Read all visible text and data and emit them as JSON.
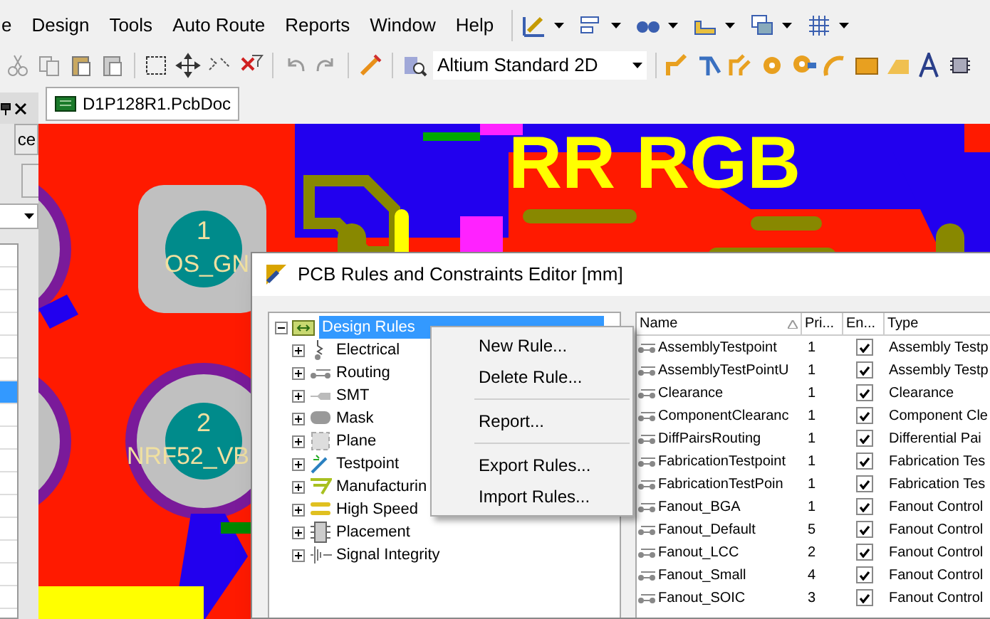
{
  "menu_bar": {
    "items": [
      "e",
      "Design",
      "Tools",
      "Auto Route",
      "Reports",
      "Window",
      "Help"
    ]
  },
  "toolbar": {
    "view_combo": {
      "value": "Altium Standard 2D"
    }
  },
  "left_panel": {
    "buttons": [
      "ce"
    ],
    "rows": [
      {
        "selected": false
      },
      {
        "selected": false
      },
      {
        "selected": false
      },
      {
        "selected": false
      },
      {
        "selected": false
      },
      {
        "selected": false
      },
      {
        "selected": true
      },
      {
        "selected": false
      },
      {
        "selected": false
      },
      {
        "selected": false
      },
      {
        "selected": false
      },
      {
        "selected": false
      },
      {
        "selected": false
      },
      {
        "selected": false
      },
      {
        "selected": false
      },
      {
        "selected": false
      }
    ]
  },
  "document_tabs": [
    {
      "label": "D1P128R1.PcbDoc",
      "selected": true
    }
  ],
  "pcb_canvas": {
    "silkscreen_text": "RR RGB",
    "pads": [
      {
        "number": "1",
        "net": "OS_GN"
      },
      {
        "number": "2",
        "net": "NRF52_VB"
      }
    ]
  },
  "dialog": {
    "title": "PCB Rules and Constraints Editor [mm]",
    "tree": {
      "label": "Design Rules",
      "expanded": true,
      "selected": true,
      "children": [
        {
          "label": "Electrical",
          "expanded": false
        },
        {
          "label": "Routing",
          "expanded": false
        },
        {
          "label": "SMT",
          "expanded": false
        },
        {
          "label": "Mask",
          "expanded": false
        },
        {
          "label": "Plane",
          "expanded": false
        },
        {
          "label": "Testpoint",
          "expanded": false
        },
        {
          "label": "Manufacturin",
          "expanded": false
        },
        {
          "label": "High Speed",
          "expanded": false
        },
        {
          "label": "Placement",
          "expanded": false
        },
        {
          "label": "Signal Integrity",
          "expanded": false
        }
      ]
    },
    "context_menu": [
      {
        "kind": "item",
        "label": "New Rule..."
      },
      {
        "kind": "item",
        "label": "Delete Rule..."
      },
      {
        "kind": "separator"
      },
      {
        "kind": "item",
        "label": "Report..."
      },
      {
        "kind": "separator"
      },
      {
        "kind": "item",
        "label": "Export Rules..."
      },
      {
        "kind": "item",
        "label": "Import Rules..."
      }
    ],
    "rules_table": {
      "columns": [
        "Name",
        "Pri...",
        "En...",
        "Type"
      ],
      "rows": [
        {
          "name": "AssemblyTestpoint",
          "priority": "1",
          "enabled": true,
          "type": "Assembly Testp"
        },
        {
          "name": "AssemblyTestPointU",
          "priority": "1",
          "enabled": true,
          "type": "Assembly Testp"
        },
        {
          "name": "Clearance",
          "priority": "1",
          "enabled": true,
          "type": "Clearance"
        },
        {
          "name": "ComponentClearanc",
          "priority": "1",
          "enabled": true,
          "type": "Component Cle"
        },
        {
          "name": "DiffPairsRouting",
          "priority": "1",
          "enabled": true,
          "type": "Differential Pai"
        },
        {
          "name": "FabricationTestpoint",
          "priority": "1",
          "enabled": true,
          "type": "Fabrication Tes"
        },
        {
          "name": "FabricationTestPoin",
          "priority": "1",
          "enabled": true,
          "type": "Fabrication Tes"
        },
        {
          "name": "Fanout_BGA",
          "priority": "1",
          "enabled": true,
          "type": "Fanout Control"
        },
        {
          "name": "Fanout_Default",
          "priority": "5",
          "enabled": true,
          "type": "Fanout Control"
        },
        {
          "name": "Fanout_LCC",
          "priority": "2",
          "enabled": true,
          "type": "Fanout Control"
        },
        {
          "name": "Fanout_Small",
          "priority": "4",
          "enabled": true,
          "type": "Fanout Control"
        },
        {
          "name": "Fanout_SOIC",
          "priority": "3",
          "enabled": true,
          "type": "Fanout Control"
        }
      ]
    }
  }
}
